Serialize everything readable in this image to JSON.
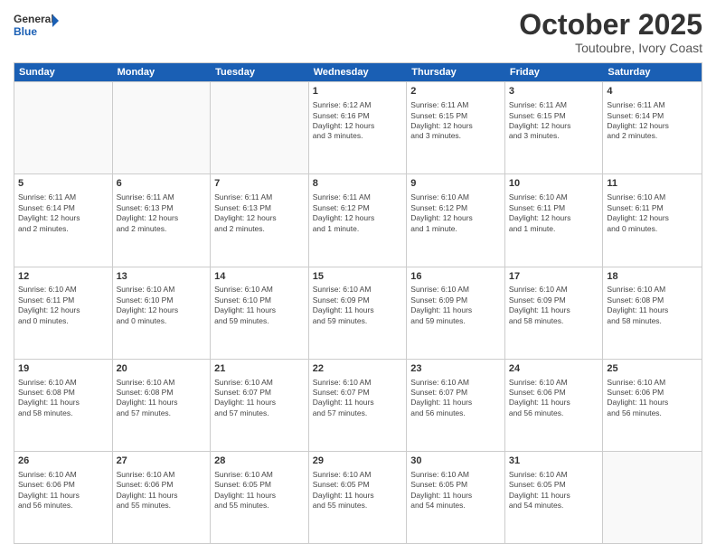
{
  "header": {
    "logo_line1": "General",
    "logo_line2": "Blue",
    "month": "October 2025",
    "location": "Toutoubre, Ivory Coast"
  },
  "weekdays": [
    "Sunday",
    "Monday",
    "Tuesday",
    "Wednesday",
    "Thursday",
    "Friday",
    "Saturday"
  ],
  "weeks": [
    [
      {
        "day": "",
        "info": ""
      },
      {
        "day": "",
        "info": ""
      },
      {
        "day": "",
        "info": ""
      },
      {
        "day": "1",
        "info": "Sunrise: 6:12 AM\nSunset: 6:16 PM\nDaylight: 12 hours\nand 3 minutes."
      },
      {
        "day": "2",
        "info": "Sunrise: 6:11 AM\nSunset: 6:15 PM\nDaylight: 12 hours\nand 3 minutes."
      },
      {
        "day": "3",
        "info": "Sunrise: 6:11 AM\nSunset: 6:15 PM\nDaylight: 12 hours\nand 3 minutes."
      },
      {
        "day": "4",
        "info": "Sunrise: 6:11 AM\nSunset: 6:14 PM\nDaylight: 12 hours\nand 2 minutes."
      }
    ],
    [
      {
        "day": "5",
        "info": "Sunrise: 6:11 AM\nSunset: 6:14 PM\nDaylight: 12 hours\nand 2 minutes."
      },
      {
        "day": "6",
        "info": "Sunrise: 6:11 AM\nSunset: 6:13 PM\nDaylight: 12 hours\nand 2 minutes."
      },
      {
        "day": "7",
        "info": "Sunrise: 6:11 AM\nSunset: 6:13 PM\nDaylight: 12 hours\nand 2 minutes."
      },
      {
        "day": "8",
        "info": "Sunrise: 6:11 AM\nSunset: 6:12 PM\nDaylight: 12 hours\nand 1 minute."
      },
      {
        "day": "9",
        "info": "Sunrise: 6:10 AM\nSunset: 6:12 PM\nDaylight: 12 hours\nand 1 minute."
      },
      {
        "day": "10",
        "info": "Sunrise: 6:10 AM\nSunset: 6:11 PM\nDaylight: 12 hours\nand 1 minute."
      },
      {
        "day": "11",
        "info": "Sunrise: 6:10 AM\nSunset: 6:11 PM\nDaylight: 12 hours\nand 0 minutes."
      }
    ],
    [
      {
        "day": "12",
        "info": "Sunrise: 6:10 AM\nSunset: 6:11 PM\nDaylight: 12 hours\nand 0 minutes."
      },
      {
        "day": "13",
        "info": "Sunrise: 6:10 AM\nSunset: 6:10 PM\nDaylight: 12 hours\nand 0 minutes."
      },
      {
        "day": "14",
        "info": "Sunrise: 6:10 AM\nSunset: 6:10 PM\nDaylight: 11 hours\nand 59 minutes."
      },
      {
        "day": "15",
        "info": "Sunrise: 6:10 AM\nSunset: 6:09 PM\nDaylight: 11 hours\nand 59 minutes."
      },
      {
        "day": "16",
        "info": "Sunrise: 6:10 AM\nSunset: 6:09 PM\nDaylight: 11 hours\nand 59 minutes."
      },
      {
        "day": "17",
        "info": "Sunrise: 6:10 AM\nSunset: 6:09 PM\nDaylight: 11 hours\nand 58 minutes."
      },
      {
        "day": "18",
        "info": "Sunrise: 6:10 AM\nSunset: 6:08 PM\nDaylight: 11 hours\nand 58 minutes."
      }
    ],
    [
      {
        "day": "19",
        "info": "Sunrise: 6:10 AM\nSunset: 6:08 PM\nDaylight: 11 hours\nand 58 minutes."
      },
      {
        "day": "20",
        "info": "Sunrise: 6:10 AM\nSunset: 6:08 PM\nDaylight: 11 hours\nand 57 minutes."
      },
      {
        "day": "21",
        "info": "Sunrise: 6:10 AM\nSunset: 6:07 PM\nDaylight: 11 hours\nand 57 minutes."
      },
      {
        "day": "22",
        "info": "Sunrise: 6:10 AM\nSunset: 6:07 PM\nDaylight: 11 hours\nand 57 minutes."
      },
      {
        "day": "23",
        "info": "Sunrise: 6:10 AM\nSunset: 6:07 PM\nDaylight: 11 hours\nand 56 minutes."
      },
      {
        "day": "24",
        "info": "Sunrise: 6:10 AM\nSunset: 6:06 PM\nDaylight: 11 hours\nand 56 minutes."
      },
      {
        "day": "25",
        "info": "Sunrise: 6:10 AM\nSunset: 6:06 PM\nDaylight: 11 hours\nand 56 minutes."
      }
    ],
    [
      {
        "day": "26",
        "info": "Sunrise: 6:10 AM\nSunset: 6:06 PM\nDaylight: 11 hours\nand 56 minutes."
      },
      {
        "day": "27",
        "info": "Sunrise: 6:10 AM\nSunset: 6:06 PM\nDaylight: 11 hours\nand 55 minutes."
      },
      {
        "day": "28",
        "info": "Sunrise: 6:10 AM\nSunset: 6:05 PM\nDaylight: 11 hours\nand 55 minutes."
      },
      {
        "day": "29",
        "info": "Sunrise: 6:10 AM\nSunset: 6:05 PM\nDaylight: 11 hours\nand 55 minutes."
      },
      {
        "day": "30",
        "info": "Sunrise: 6:10 AM\nSunset: 6:05 PM\nDaylight: 11 hours\nand 54 minutes."
      },
      {
        "day": "31",
        "info": "Sunrise: 6:10 AM\nSunset: 6:05 PM\nDaylight: 11 hours\nand 54 minutes."
      },
      {
        "day": "",
        "info": ""
      }
    ]
  ]
}
